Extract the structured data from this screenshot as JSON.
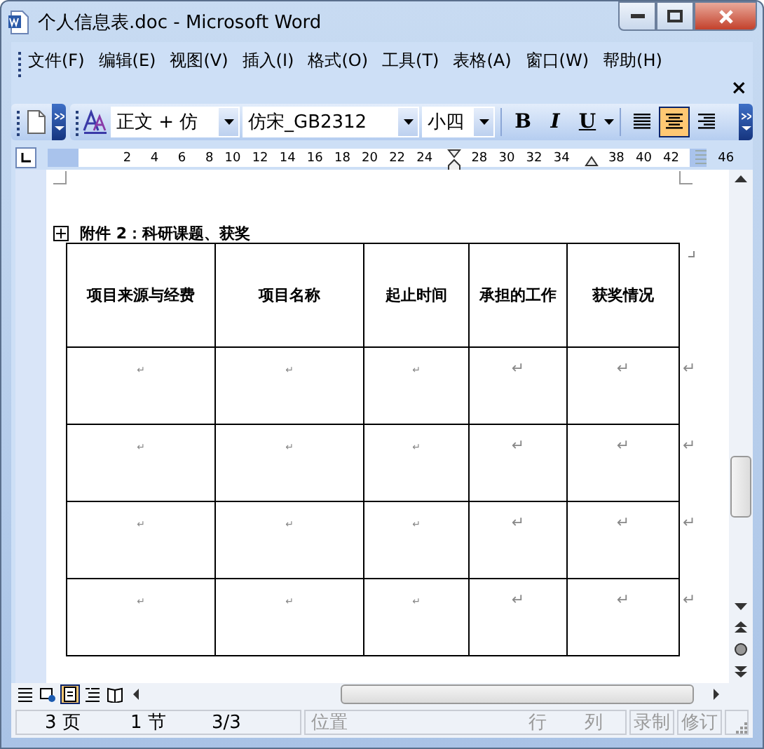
{
  "window": {
    "title": "个人信息表.doc - Microsoft Word"
  },
  "menu": {
    "items": [
      "文件(F)",
      "编辑(E)",
      "视图(V)",
      "插入(I)",
      "格式(O)",
      "工具(T)",
      "表格(A)",
      "窗口(W)",
      "帮助(H)"
    ],
    "close": "×"
  },
  "toolbar": {
    "style": "正文 + 仿",
    "font": "仿宋_GB2312",
    "size": "小四",
    "format_buttons": [
      {
        "label": "B",
        "kind": "bold"
      },
      {
        "label": "I",
        "kind": "italic"
      },
      {
        "label": "U",
        "kind": "underline"
      }
    ],
    "alignment": [
      {
        "kind": "justify",
        "selected": false
      },
      {
        "kind": "center",
        "selected": true
      },
      {
        "kind": "right",
        "selected": false
      }
    ]
  },
  "ruler": {
    "slots": [
      {
        "kind": "number",
        "label": "2"
      },
      {
        "kind": "number",
        "label": "4"
      },
      {
        "kind": "number",
        "label": "6"
      },
      {
        "kind": "number",
        "label": "8"
      },
      {
        "kind": "number",
        "label": "10"
      },
      {
        "kind": "number",
        "label": "12"
      },
      {
        "kind": "number",
        "label": "14"
      },
      {
        "kind": "number",
        "label": "16"
      },
      {
        "kind": "number",
        "label": "18"
      },
      {
        "kind": "number",
        "label": "20"
      },
      {
        "kind": "number",
        "label": "22"
      },
      {
        "kind": "number",
        "label": "24"
      },
      {
        "kind": "indent"
      },
      {
        "kind": "number",
        "label": "28"
      },
      {
        "kind": "number",
        "label": "30"
      },
      {
        "kind": "number",
        "label": "32"
      },
      {
        "kind": "number",
        "label": "34"
      },
      {
        "kind": "right-indent"
      },
      {
        "kind": "number",
        "label": "38"
      },
      {
        "kind": "number",
        "label": "40"
      },
      {
        "kind": "number",
        "label": "42"
      },
      {
        "kind": "column"
      },
      {
        "kind": "number",
        "label": "46"
      }
    ]
  },
  "document": {
    "heading": "附件 2：科研课题、获奖",
    "table": {
      "columns": [
        "项目来源与经费",
        "项目名称",
        "起止时间",
        "承担的工作",
        "获奖情况"
      ],
      "rows": [
        {
          "cells": [
            "↵",
            "↵",
            "↵",
            "↵",
            "↵"
          ],
          "end": "↵"
        },
        {
          "cells": [
            "↵",
            "↵",
            "↵",
            "↵",
            "↵"
          ],
          "end": "↵"
        },
        {
          "cells": [
            "↵",
            "↵",
            "↵",
            "↵",
            "↵"
          ],
          "end": "↵"
        },
        {
          "cells": [
            "↵",
            "↵",
            "↵",
            "↵",
            "↵"
          ],
          "end": "↵"
        }
      ]
    }
  },
  "view_buttons": [
    {
      "kind": "normal",
      "selected": false
    },
    {
      "kind": "web",
      "selected": false
    },
    {
      "kind": "print",
      "selected": true
    },
    {
      "kind": "outline",
      "selected": false
    },
    {
      "kind": "reading",
      "selected": false
    }
  ],
  "status_bar": [
    {
      "text": "3 页",
      "disabled": false
    },
    {
      "text": "1 节",
      "disabled": false
    },
    {
      "text": "3/3",
      "disabled": false
    },
    {
      "text": "位置",
      "disabled": true
    },
    {
      "text": "行",
      "disabled": true
    },
    {
      "text": "列",
      "disabled": true
    },
    {
      "text": "录制",
      "disabled": true
    },
    {
      "text": "修订",
      "disabled": true
    }
  ]
}
